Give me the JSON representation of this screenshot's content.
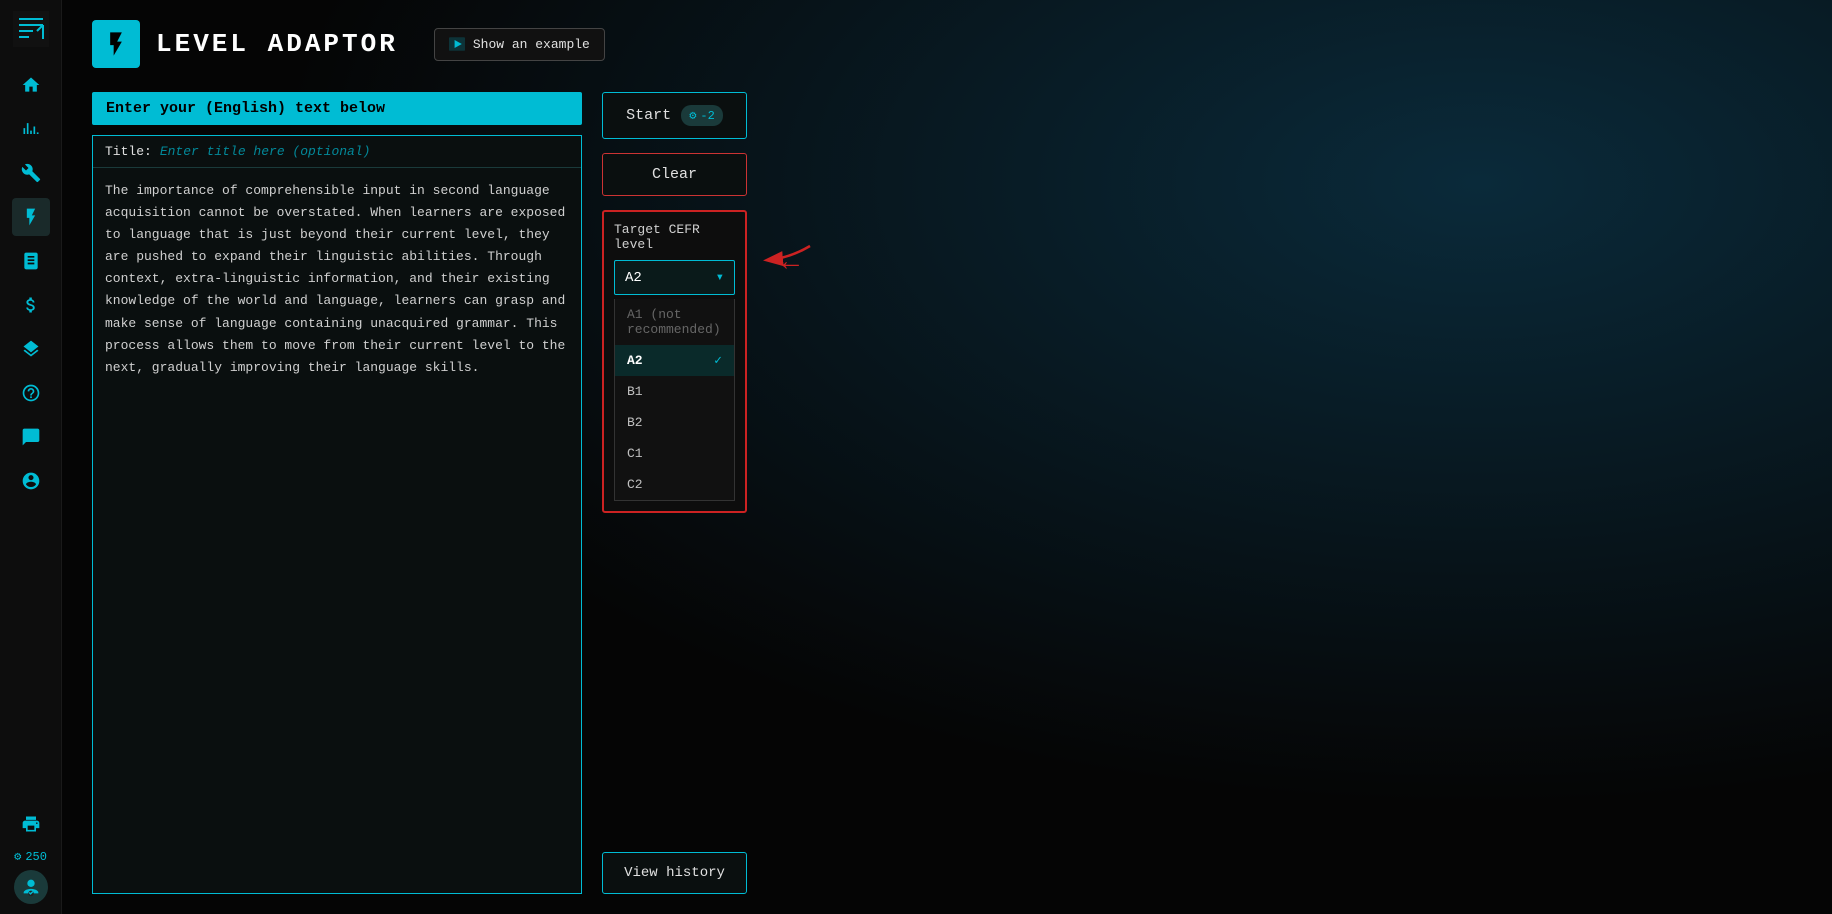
{
  "app": {
    "title": "LEVEL ADAPTOR"
  },
  "sidebar": {
    "items": [
      {
        "name": "home-icon",
        "icon": "⌂",
        "active": false
      },
      {
        "name": "analytics-icon",
        "icon": "📈",
        "active": false
      },
      {
        "name": "tools-icon",
        "icon": "🔧",
        "active": false
      },
      {
        "name": "level-adaptor-icon",
        "icon": "⚡",
        "active": true
      },
      {
        "name": "library-icon",
        "icon": "📚",
        "active": false
      },
      {
        "name": "pricing-icon",
        "icon": "💲",
        "active": false
      },
      {
        "name": "stack-icon",
        "icon": "📦",
        "active": false
      },
      {
        "name": "help-icon",
        "icon": "❓",
        "active": false
      },
      {
        "name": "chat-icon",
        "icon": "💬",
        "active": false
      },
      {
        "name": "user-icon",
        "icon": "👤",
        "active": false
      },
      {
        "name": "print-icon",
        "icon": "🖨",
        "active": false
      }
    ],
    "credits": "250",
    "credits_icon": "⚙"
  },
  "header": {
    "icon": "⚡",
    "title": "LEVEL ADAPTOR",
    "show_example_label": "Show an example",
    "show_example_icon": "🖼"
  },
  "input_area": {
    "enter_text_label": "Enter your (English) text below",
    "title_label": "Title:",
    "title_placeholder": "Enter title here (optional)",
    "text_content": "The importance of comprehensible input in second language acquisition cannot be overstated. When learners are exposed to language that is just beyond their current level, they are pushed to expand their linguistic abilities. Through context, extra-linguistic information, and their existing knowledge of the world and language, learners can grasp and make sense of language containing unacquired grammar. This process allows them to move from their current level to the next, gradually improving their language skills."
  },
  "controls": {
    "start_label": "Start",
    "start_credit_icon": "⚙",
    "start_credit_value": "-2",
    "clear_label": "Clear",
    "view_history_label": "View history"
  },
  "cefr": {
    "label": "Target CEFR level",
    "selected": "A2",
    "chevron": "▾",
    "options": [
      {
        "value": "A1 (not recommended)",
        "selected": false,
        "disabled": true
      },
      {
        "value": "A2",
        "selected": true,
        "disabled": false
      },
      {
        "value": "B1",
        "selected": false,
        "disabled": false
      },
      {
        "value": "B2",
        "selected": false,
        "disabled": false
      },
      {
        "value": "C1",
        "selected": false,
        "disabled": false
      },
      {
        "value": "C2",
        "selected": false,
        "disabled": false
      }
    ]
  }
}
